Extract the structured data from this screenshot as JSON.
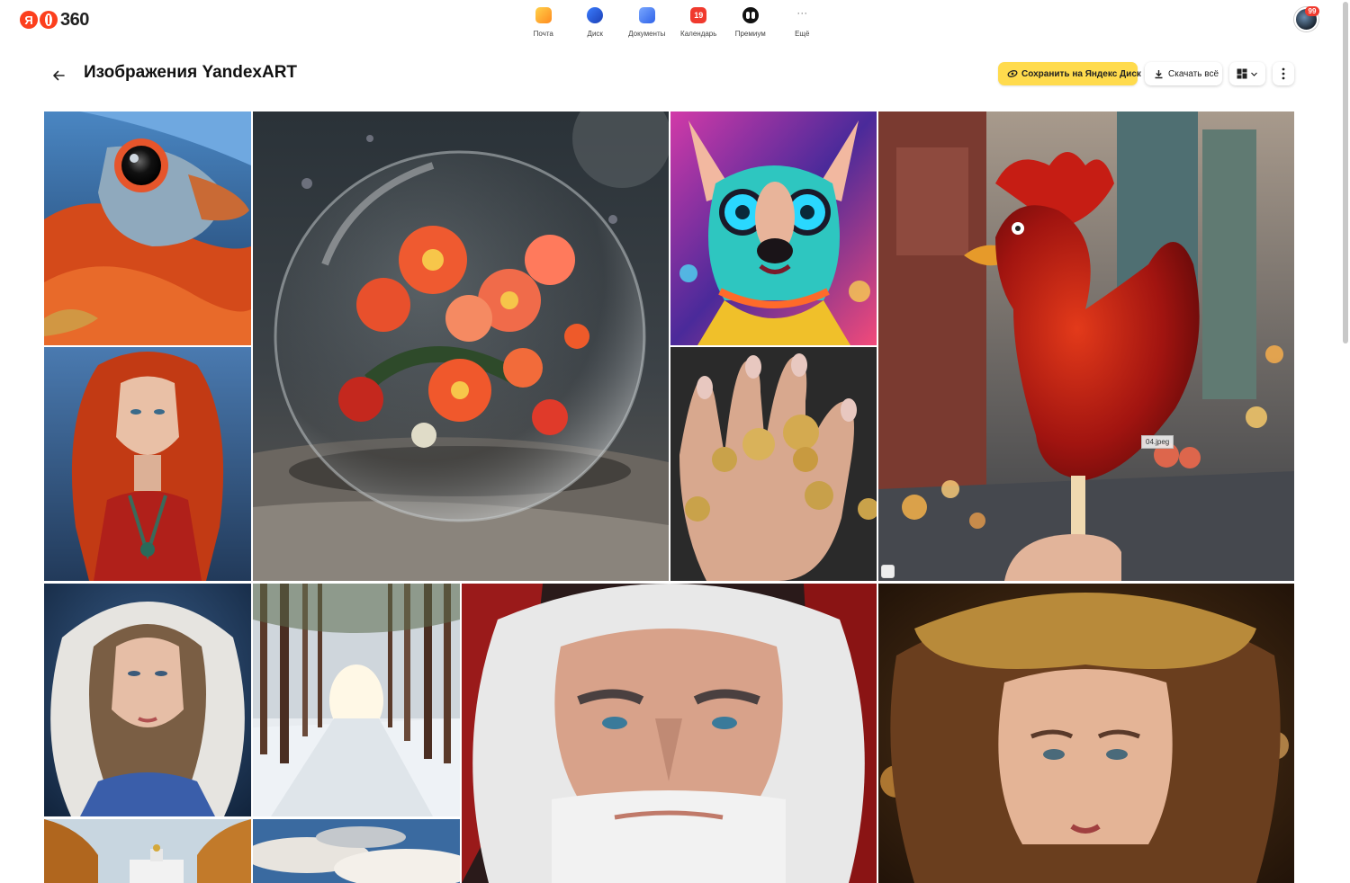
{
  "logo": {
    "ya": "Я",
    "num": "360"
  },
  "apps": [
    {
      "id": "mail",
      "label": "Почта",
      "icon": "mail-icon"
    },
    {
      "id": "disk",
      "label": "Диск",
      "icon": "disk-icon"
    },
    {
      "id": "docs",
      "label": "Документы",
      "icon": "documents-icon"
    },
    {
      "id": "cal",
      "label": "Календарь",
      "icon": "calendar-icon",
      "icon_text": "19"
    },
    {
      "id": "prem",
      "label": "Премиум",
      "icon": "premium-icon"
    },
    {
      "id": "more",
      "label": "Ещё",
      "icon": "more-icon",
      "icon_text": "···"
    }
  ],
  "user": {
    "notifications": "99"
  },
  "header": {
    "title": "Изображения YandexART",
    "save_label": "Сохранить на Яндекс Диск",
    "download_label": "Скачать всё"
  },
  "hover_file": "04.jpeg",
  "colors": {
    "accent_yellow": "#ffdb4d",
    "badge_red": "#f03a2e"
  },
  "gallery": [
    {
      "id": "bird",
      "subject": "bird-eye-closeup"
    },
    {
      "id": "sphere",
      "subject": "flowers-in-glass-sphere"
    },
    {
      "id": "dog",
      "subject": "neon-dog"
    },
    {
      "id": "rooster",
      "subject": "rooster-lollipop"
    },
    {
      "id": "redhead",
      "subject": "red-haired-woman"
    },
    {
      "id": "rings",
      "subject": "hand-with-gold-rings"
    },
    {
      "id": "fur",
      "subject": "woman-in-fur-hood"
    },
    {
      "id": "forest",
      "subject": "snowy-pine-forest"
    },
    {
      "id": "santa",
      "subject": "santa-portrait"
    },
    {
      "id": "gold",
      "subject": "woman-with-golden-headdress"
    },
    {
      "id": "palace",
      "subject": "autumn-palace"
    },
    {
      "id": "clouds",
      "subject": "sky-clouds"
    }
  ]
}
